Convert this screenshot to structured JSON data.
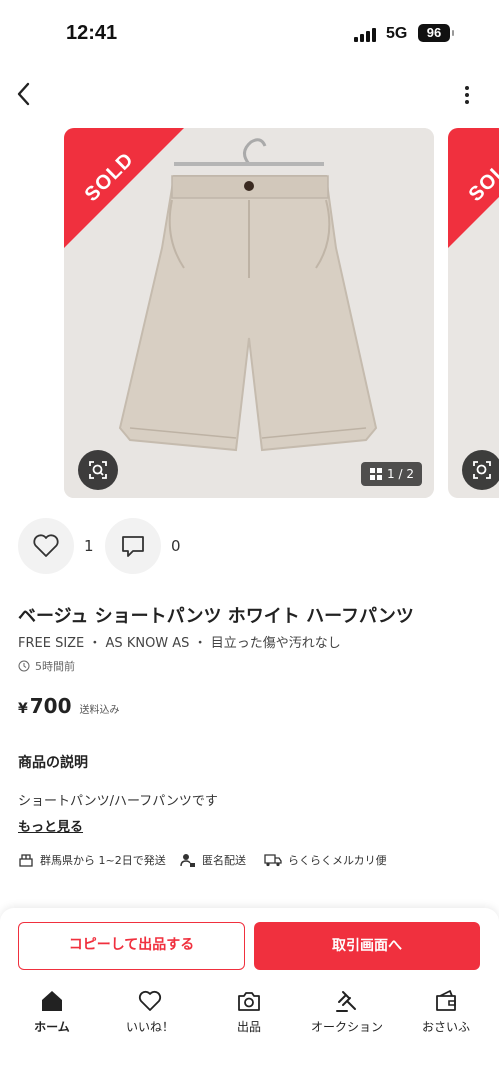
{
  "status_bar": {
    "time": "12:41",
    "network": "5G",
    "battery": "96"
  },
  "product": {
    "sold_label": "SOLD",
    "image_counter": "1 / 2",
    "likes": "1",
    "comments": "0",
    "title": "ベージュ ショートパンツ ホワイト ハーフパンツ",
    "attributes": "FREE SIZE ・ AS KNOW AS ・ 目立った傷や汚れなし",
    "posted": "5時間前",
    "price_symbol": "¥",
    "price": "700",
    "shipping_note": "送料込み"
  },
  "description": {
    "heading": "商品の説明",
    "body": "ショートパンツ/ハーフパンツです",
    "see_more": "もっと見る"
  },
  "shipping": {
    "origin": "群馬県から 1~2日で発送",
    "anonymous": "匿名配送",
    "method": "らくらくメルカリ便"
  },
  "actions": {
    "copy_listing": "コピーして出品する",
    "transaction": "取引画面へ"
  },
  "tabs": [
    {
      "label": "ホーム",
      "icon": "home-icon"
    },
    {
      "label": "いいね！",
      "icon": "heart-icon"
    },
    {
      "label": "出品",
      "icon": "camera-icon"
    },
    {
      "label": "オークション",
      "icon": "gavel-icon"
    },
    {
      "label": "おさいふ",
      "icon": "wallet-icon"
    }
  ],
  "colors": {
    "accent": "#f0303e",
    "text": "#222222",
    "image_bg": "#e9e6e3"
  }
}
